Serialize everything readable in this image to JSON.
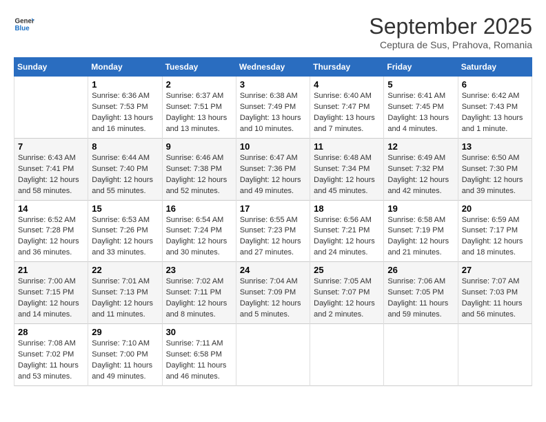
{
  "header": {
    "logo_line1": "General",
    "logo_line2": "Blue",
    "month": "September 2025",
    "location": "Ceptura de Sus, Prahova, Romania"
  },
  "weekdays": [
    "Sunday",
    "Monday",
    "Tuesday",
    "Wednesday",
    "Thursday",
    "Friday",
    "Saturday"
  ],
  "weeks": [
    [
      {
        "day": "",
        "info": ""
      },
      {
        "day": "1",
        "info": "Sunrise: 6:36 AM\nSunset: 7:53 PM\nDaylight: 13 hours\nand 16 minutes."
      },
      {
        "day": "2",
        "info": "Sunrise: 6:37 AM\nSunset: 7:51 PM\nDaylight: 13 hours\nand 13 minutes."
      },
      {
        "day": "3",
        "info": "Sunrise: 6:38 AM\nSunset: 7:49 PM\nDaylight: 13 hours\nand 10 minutes."
      },
      {
        "day": "4",
        "info": "Sunrise: 6:40 AM\nSunset: 7:47 PM\nDaylight: 13 hours\nand 7 minutes."
      },
      {
        "day": "5",
        "info": "Sunrise: 6:41 AM\nSunset: 7:45 PM\nDaylight: 13 hours\nand 4 minutes."
      },
      {
        "day": "6",
        "info": "Sunrise: 6:42 AM\nSunset: 7:43 PM\nDaylight: 13 hours\nand 1 minute."
      }
    ],
    [
      {
        "day": "7",
        "info": "Sunrise: 6:43 AM\nSunset: 7:41 PM\nDaylight: 12 hours\nand 58 minutes."
      },
      {
        "day": "8",
        "info": "Sunrise: 6:44 AM\nSunset: 7:40 PM\nDaylight: 12 hours\nand 55 minutes."
      },
      {
        "day": "9",
        "info": "Sunrise: 6:46 AM\nSunset: 7:38 PM\nDaylight: 12 hours\nand 52 minutes."
      },
      {
        "day": "10",
        "info": "Sunrise: 6:47 AM\nSunset: 7:36 PM\nDaylight: 12 hours\nand 49 minutes."
      },
      {
        "day": "11",
        "info": "Sunrise: 6:48 AM\nSunset: 7:34 PM\nDaylight: 12 hours\nand 45 minutes."
      },
      {
        "day": "12",
        "info": "Sunrise: 6:49 AM\nSunset: 7:32 PM\nDaylight: 12 hours\nand 42 minutes."
      },
      {
        "day": "13",
        "info": "Sunrise: 6:50 AM\nSunset: 7:30 PM\nDaylight: 12 hours\nand 39 minutes."
      }
    ],
    [
      {
        "day": "14",
        "info": "Sunrise: 6:52 AM\nSunset: 7:28 PM\nDaylight: 12 hours\nand 36 minutes."
      },
      {
        "day": "15",
        "info": "Sunrise: 6:53 AM\nSunset: 7:26 PM\nDaylight: 12 hours\nand 33 minutes."
      },
      {
        "day": "16",
        "info": "Sunrise: 6:54 AM\nSunset: 7:24 PM\nDaylight: 12 hours\nand 30 minutes."
      },
      {
        "day": "17",
        "info": "Sunrise: 6:55 AM\nSunset: 7:23 PM\nDaylight: 12 hours\nand 27 minutes."
      },
      {
        "day": "18",
        "info": "Sunrise: 6:56 AM\nSunset: 7:21 PM\nDaylight: 12 hours\nand 24 minutes."
      },
      {
        "day": "19",
        "info": "Sunrise: 6:58 AM\nSunset: 7:19 PM\nDaylight: 12 hours\nand 21 minutes."
      },
      {
        "day": "20",
        "info": "Sunrise: 6:59 AM\nSunset: 7:17 PM\nDaylight: 12 hours\nand 18 minutes."
      }
    ],
    [
      {
        "day": "21",
        "info": "Sunrise: 7:00 AM\nSunset: 7:15 PM\nDaylight: 12 hours\nand 14 minutes."
      },
      {
        "day": "22",
        "info": "Sunrise: 7:01 AM\nSunset: 7:13 PM\nDaylight: 12 hours\nand 11 minutes."
      },
      {
        "day": "23",
        "info": "Sunrise: 7:02 AM\nSunset: 7:11 PM\nDaylight: 12 hours\nand 8 minutes."
      },
      {
        "day": "24",
        "info": "Sunrise: 7:04 AM\nSunset: 7:09 PM\nDaylight: 12 hours\nand 5 minutes."
      },
      {
        "day": "25",
        "info": "Sunrise: 7:05 AM\nSunset: 7:07 PM\nDaylight: 12 hours\nand 2 minutes."
      },
      {
        "day": "26",
        "info": "Sunrise: 7:06 AM\nSunset: 7:05 PM\nDaylight: 11 hours\nand 59 minutes."
      },
      {
        "day": "27",
        "info": "Sunrise: 7:07 AM\nSunset: 7:03 PM\nDaylight: 11 hours\nand 56 minutes."
      }
    ],
    [
      {
        "day": "28",
        "info": "Sunrise: 7:08 AM\nSunset: 7:02 PM\nDaylight: 11 hours\nand 53 minutes."
      },
      {
        "day": "29",
        "info": "Sunrise: 7:10 AM\nSunset: 7:00 PM\nDaylight: 11 hours\nand 49 minutes."
      },
      {
        "day": "30",
        "info": "Sunrise: 7:11 AM\nSunset: 6:58 PM\nDaylight: 11 hours\nand 46 minutes."
      },
      {
        "day": "",
        "info": ""
      },
      {
        "day": "",
        "info": ""
      },
      {
        "day": "",
        "info": ""
      },
      {
        "day": "",
        "info": ""
      }
    ]
  ]
}
